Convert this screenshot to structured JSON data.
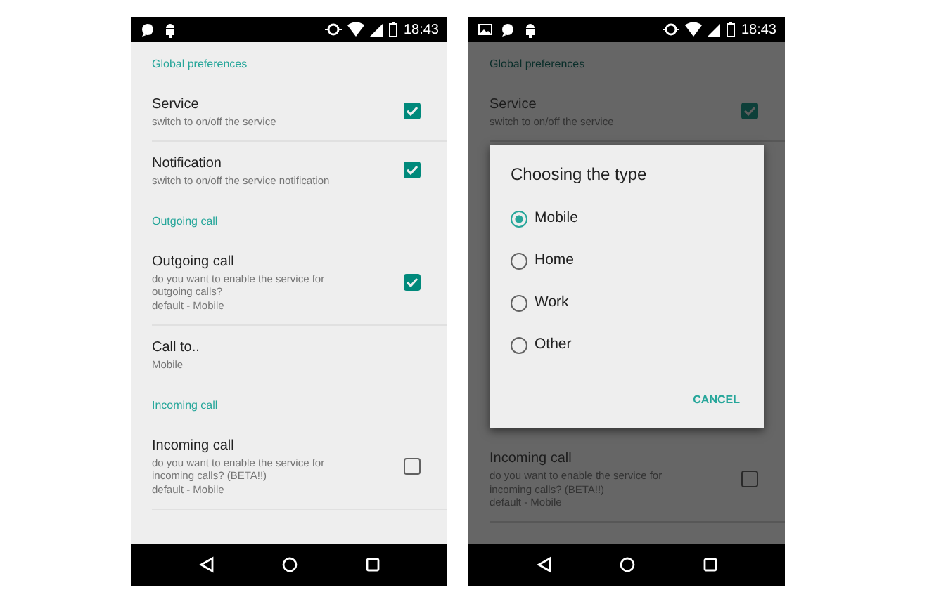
{
  "screens": [
    {
      "dimmed": false,
      "status_bar": {
        "notification_icons": [
          {
            "kind": "bubble"
          },
          {
            "kind": "robot"
          }
        ],
        "time": "18:43"
      },
      "list": [
        {
          "kind": "header",
          "text": "Global preferences"
        },
        {
          "kind": "check",
          "title": "Service",
          "summary": [
            "switch to on/off the service"
          ],
          "checked": true,
          "divider": true
        },
        {
          "kind": "check",
          "title": "Notification",
          "summary": [
            "switch to on/off the service notification"
          ],
          "checked": true,
          "divider": false
        },
        {
          "kind": "header",
          "text": "Outgoing call"
        },
        {
          "kind": "check",
          "title": "Outgoing call",
          "summary": [
            "do you want to enable the service for",
            "outgoing calls?",
            "default - Mobile"
          ],
          "checked": true,
          "divider": true
        },
        {
          "kind": "value",
          "title": "Call to..",
          "summary": [
            "Mobile"
          ],
          "divider": false
        },
        {
          "kind": "header",
          "text": "Incoming call"
        },
        {
          "kind": "check",
          "title": "Incoming call",
          "summary": [
            "do you want to enable the service for",
            "incoming calls? (BETA!!)",
            "default - Mobile"
          ],
          "checked": false,
          "divider": true
        }
      ]
    },
    {
      "dimmed": true,
      "status_bar": {
        "notification_icons": [
          {
            "kind": "image"
          },
          {
            "kind": "bubble"
          },
          {
            "kind": "robot"
          }
        ],
        "time": "18:43"
      },
      "list": [
        {
          "kind": "header",
          "text": "Global preferences"
        },
        {
          "kind": "check",
          "title": "Service",
          "summary": [
            "switch to on/off the service"
          ],
          "checked": true,
          "divider": true
        },
        {
          "kind": "dialog",
          "title": "Choosing the type",
          "options": [
            {
              "label": "Mobile",
              "selected": true
            },
            {
              "label": "Home",
              "selected": false
            },
            {
              "label": "Work",
              "selected": false
            },
            {
              "label": "Other",
              "selected": false
            }
          ],
          "button": "CANCEL"
        },
        {
          "kind": "check",
          "title": "Incoming call",
          "summary": [
            "do you want to enable the service for",
            "incoming calls? (BETA!!)",
            "default - Mobile"
          ],
          "checked": false,
          "divider": true
        }
      ]
    }
  ]
}
